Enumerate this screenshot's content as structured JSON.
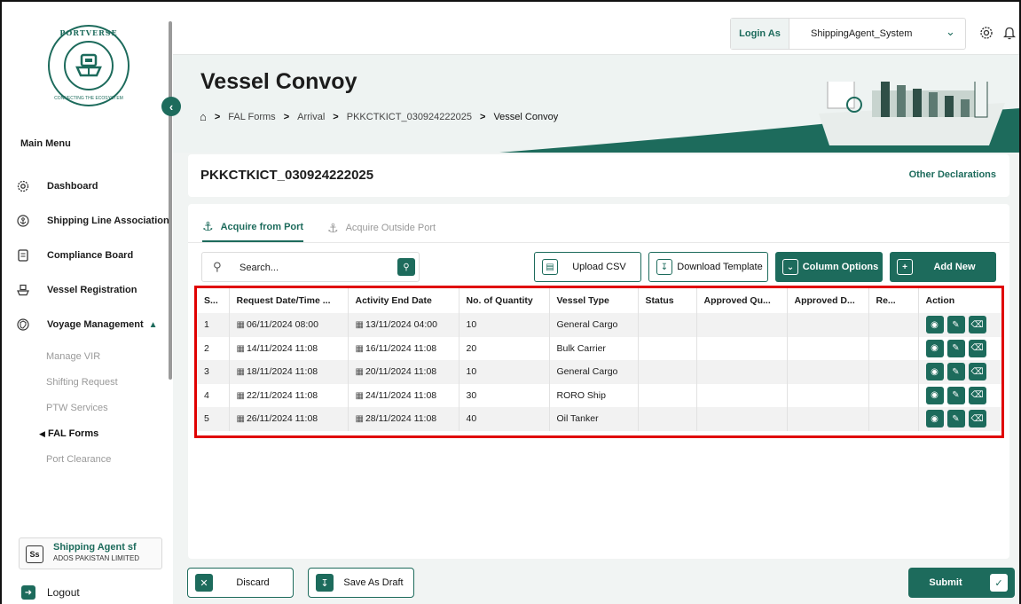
{
  "app": {
    "logo_text": "PORTVERSE",
    "logo_tagline": "CONNECTING THE ECOSYSTEM"
  },
  "sidebar": {
    "main_menu_title": "Main Menu",
    "items": [
      {
        "label": "Dashboard",
        "icon": "gear-icon"
      },
      {
        "label": "Shipping Line Association",
        "icon": "anchor-icon"
      },
      {
        "label": "Compliance Board",
        "icon": "document-icon"
      },
      {
        "label": "Vessel Registration",
        "icon": "ship-icon"
      },
      {
        "label": "Voyage Management",
        "icon": "shield-icon",
        "expanded": true
      }
    ],
    "submenu": [
      {
        "label": "Manage VIR"
      },
      {
        "label": "Shifting Request"
      },
      {
        "label": "PTW Services"
      },
      {
        "label": "FAL Forms",
        "active": true
      },
      {
        "label": "Port Clearance"
      }
    ],
    "user": {
      "initials": "Ss",
      "name": "Shipping Agent sf",
      "org": "ADOS PAKISTAN LIMITED"
    },
    "logout_label": "Logout"
  },
  "topbar": {
    "login_as_label": "Login As",
    "login_as_value": "ShippingAgent_System"
  },
  "header": {
    "title": "Vessel Convoy",
    "breadcrumb": [
      "FAL Forms",
      "Arrival",
      "PKKCTKICT_030924222025",
      "Vessel Convoy"
    ]
  },
  "declaration": {
    "id": "PKKCTKICT_030924222025",
    "other_link": "Other Declarations"
  },
  "tabs": [
    {
      "label": "Acquire from Port",
      "active": true
    },
    {
      "label": "Acquire Outside Port",
      "active": false
    }
  ],
  "toolbar": {
    "search_placeholder": "Search...",
    "upload_csv": "Upload CSV",
    "download_template": "Download Template",
    "column_options": "Column Options",
    "add_new": "Add New"
  },
  "table": {
    "columns": [
      "S...",
      "Request Date/Time ...",
      "Activity End Date",
      "No. of Quantity",
      "Vessel Type",
      "Status",
      "Approved Qu...",
      "Approved D...",
      "Re...",
      "Action"
    ],
    "rows": [
      {
        "sn": "1",
        "request": "06/11/2024 08:00",
        "end": "13/11/2024 04:00",
        "qty": "10",
        "type": "General Cargo",
        "status": "",
        "approved_qty": "",
        "approved_date": "",
        "remarks": ""
      },
      {
        "sn": "2",
        "request": "14/11/2024 11:08",
        "end": "16/11/2024 11:08",
        "qty": "20",
        "type": "Bulk Carrier",
        "status": "",
        "approved_qty": "",
        "approved_date": "",
        "remarks": ""
      },
      {
        "sn": "3",
        "request": "18/11/2024 11:08",
        "end": "20/11/2024 11:08",
        "qty": "10",
        "type": "General Cargo",
        "status": "",
        "approved_qty": "",
        "approved_date": "",
        "remarks": ""
      },
      {
        "sn": "4",
        "request": "22/11/2024 11:08",
        "end": "24/11/2024 11:08",
        "qty": "30",
        "type": "RORO Ship",
        "status": "",
        "approved_qty": "",
        "approved_date": "",
        "remarks": ""
      },
      {
        "sn": "5",
        "request": "26/11/2024 11:08",
        "end": "28/11/2024 11:08",
        "qty": "40",
        "type": "Oil Tanker",
        "status": "",
        "approved_qty": "",
        "approved_date": "",
        "remarks": ""
      }
    ]
  },
  "footer": {
    "discard": "Discard",
    "save_draft": "Save As Draft",
    "submit": "Submit"
  },
  "colors": {
    "accent": "#1d6b5c",
    "highlight": "#e00000"
  }
}
